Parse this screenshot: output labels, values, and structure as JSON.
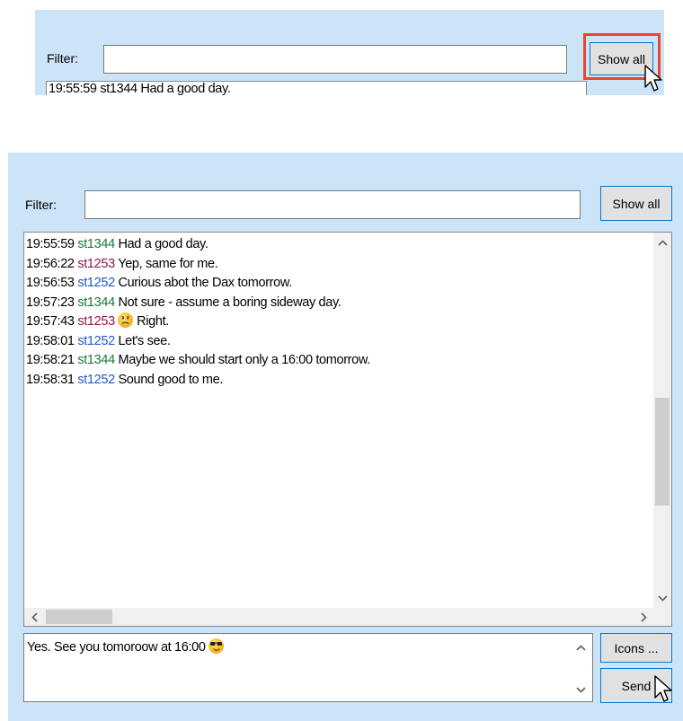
{
  "top": {
    "filter_label": "Filter:",
    "filter_value": "",
    "show_all_label": "Show all",
    "partial_line": "19:55:59 st1344 Had a good day."
  },
  "main": {
    "filter_label": "Filter:",
    "filter_value": "",
    "show_all_label": "Show all",
    "messages": [
      {
        "time": "19:55:59",
        "user": "st1344",
        "text": "Had a good day."
      },
      {
        "time": "19:56:22",
        "user": "st1253",
        "text": "Yep, same for me."
      },
      {
        "time": "19:56:53",
        "user": "st1252",
        "text": "Curious abot the Dax tomorrow."
      },
      {
        "time": "19:57:23",
        "user": "st1344",
        "text": "Not sure - assume a boring sideway day."
      },
      {
        "time": "19:57:43",
        "user": "st1253",
        "text": "Right.",
        "emoji": "sad-face-icon"
      },
      {
        "time": "19:58:01",
        "user": "st1252",
        "text": "Let's see."
      },
      {
        "time": "19:58:21",
        "user": "st1344",
        "text": "Maybe we should start only a 16:00 tomorrow."
      },
      {
        "time": "19:58:31",
        "user": "st1252",
        "text": "Sound good to me."
      }
    ],
    "compose": {
      "text": "Yes. See you tomoroow at 16:00",
      "emoji": "cool-sunglasses-icon"
    },
    "icons_label": "Icons ...",
    "send_label": "Send"
  },
  "colors": {
    "panel": "#cce4f7",
    "highlight": "#e8452c",
    "st1344": "#1a7a3a",
    "st1253": "#8a1c4a",
    "st1252": "#2358c8"
  }
}
